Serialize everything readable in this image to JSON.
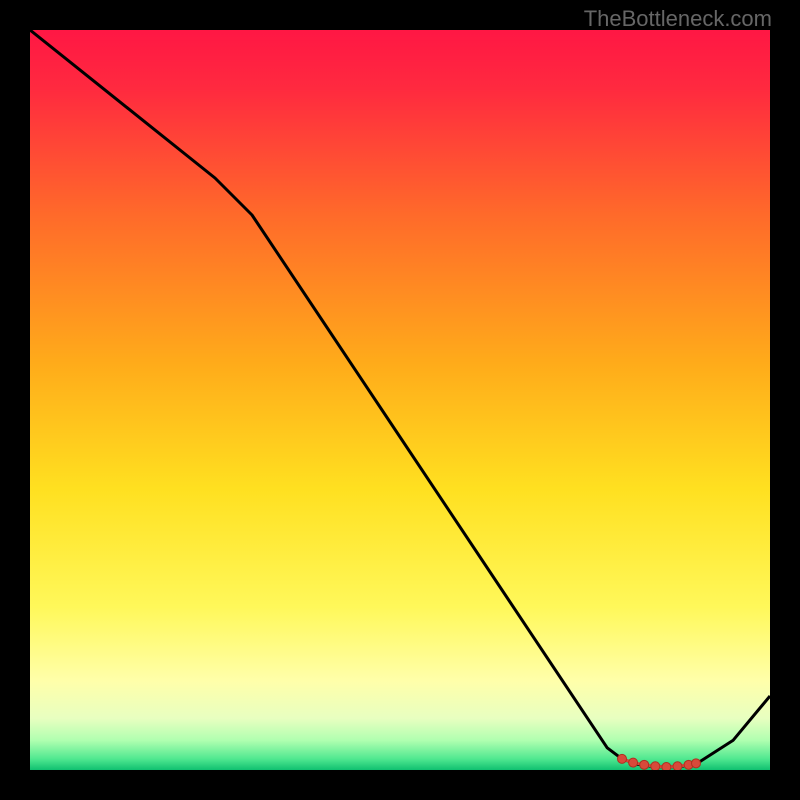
{
  "watermark": "TheBottleneck.com",
  "chart_data": {
    "type": "line",
    "title": "",
    "xlabel": "",
    "ylabel": "",
    "xlim": [
      0,
      100
    ],
    "ylim": [
      0,
      100
    ],
    "series": [
      {
        "name": "bottleneck-curve",
        "x": [
          0,
          10,
          25,
          30,
          40,
          50,
          60,
          70,
          78,
          80,
          82,
          84,
          86,
          88,
          90,
          95,
          100
        ],
        "y": [
          100,
          92,
          80,
          75,
          60,
          45,
          30,
          15,
          3,
          1.5,
          0.8,
          0.5,
          0.4,
          0.5,
          0.8,
          4,
          10
        ]
      }
    ],
    "markers": {
      "name": "optimal-range",
      "x": [
        80,
        81.5,
        83,
        84.5,
        86,
        87.5,
        89,
        90
      ],
      "y": [
        1.5,
        1.0,
        0.7,
        0.5,
        0.4,
        0.5,
        0.7,
        0.9
      ]
    },
    "gradient_meaning": "red-top-high-bottleneck to green-bottom-low-bottleneck"
  }
}
